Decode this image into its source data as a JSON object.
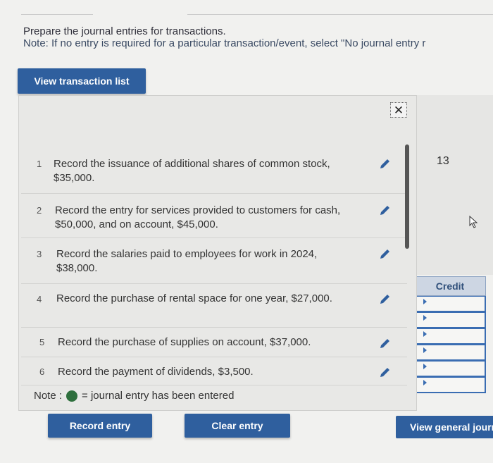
{
  "instructions": {
    "line1": "Prepare the journal entries for transactions.",
    "line2": "Note: If no entry is required for a particular transaction/event, select \"No journal entry r"
  },
  "buttons": {
    "view_transaction_list": "View transaction list",
    "record_entry": "Record entry",
    "clear_entry": "Clear entry",
    "view_general_journal": "View general journ"
  },
  "transactions": [
    {
      "num": "1",
      "text": "Record the issuance of additional shares of common stock, $35,000."
    },
    {
      "num": "2",
      "text": "Record the entry for services provided to customers for cash, $50,000, and on account, $45,000."
    },
    {
      "num": "3",
      "text": "Record the salaries paid to employees for work in 2024, $38,000."
    },
    {
      "num": "4",
      "text": "Record the purchase of rental space for one year, $27,000."
    },
    {
      "num": "5",
      "text": "Record the purchase of supplies on account, $37,000."
    },
    {
      "num": "6",
      "text": "Record the payment of dividends, $3,500."
    }
  ],
  "note": {
    "label": "Note :",
    "text": "= journal entry has been entered"
  },
  "right": {
    "page_number": "13",
    "credit_header": "Credit"
  },
  "icons": {
    "close": "close-icon",
    "edit": "pencil-icon",
    "cursor": "mouse-pointer-icon",
    "entered_marker": "green-dot-icon"
  },
  "colors": {
    "button_blue": "#2f5f9e",
    "entered_green": "#2e6f3d"
  }
}
